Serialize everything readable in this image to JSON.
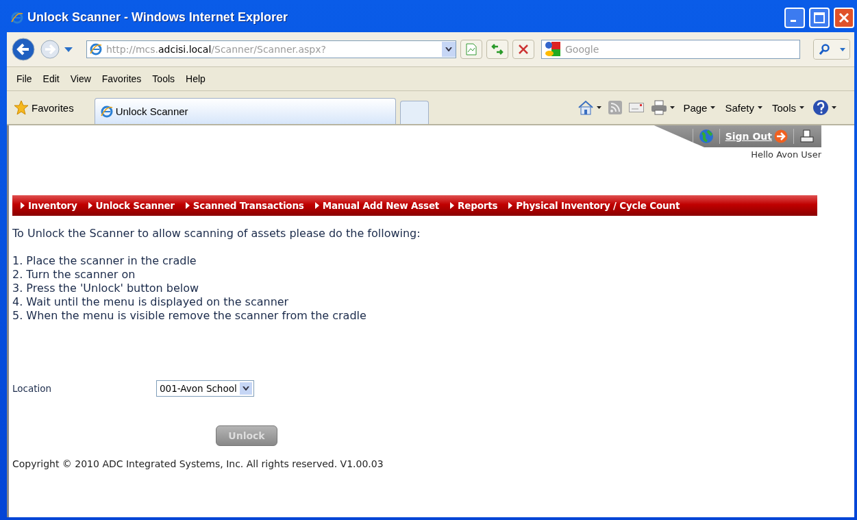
{
  "window": {
    "title": "Unlock Scanner - Windows Internet Explorer"
  },
  "address_bar": {
    "url_prefix": "http://mcs.",
    "url_host": "adcisi.local",
    "url_path": "/Scanner/Scanner.aspx?"
  },
  "search": {
    "placeholder": "Google"
  },
  "menu_bar": [
    "File",
    "Edit",
    "View",
    "Favorites",
    "Tools",
    "Help"
  ],
  "favorites_label": "Favorites",
  "tabs": [
    {
      "label": "Unlock Scanner",
      "selected": true
    }
  ],
  "command_bar": [
    "Page",
    "Safety",
    "Tools"
  ],
  "header": {
    "sign_out": "Sign Out",
    "greeting": "Hello Avon User"
  },
  "nav": [
    "Inventory",
    "Unlock Scanner",
    "Scanned Transactions",
    "Manual Add New Asset",
    "Reports",
    "Physical Inventory / Cycle Count"
  ],
  "intro": "To Unlock the Scanner to allow scanning of assets please do the following:",
  "steps": [
    "1. Place the scanner in the cradle",
    "2. Turn the scanner on",
    "3. Press the 'Unlock' button below",
    "4. Wait until the menu is displayed on the scanner",
    "5. When the menu is visible remove the scanner from the cradle"
  ],
  "location": {
    "label": "Location",
    "value": "001-Avon School"
  },
  "unlock_button": {
    "label": "Unlock",
    "disabled": true
  },
  "footer": "Copyright © 2010 ADC Integrated Systems, Inc. All rights reserved. V1.00.03"
}
